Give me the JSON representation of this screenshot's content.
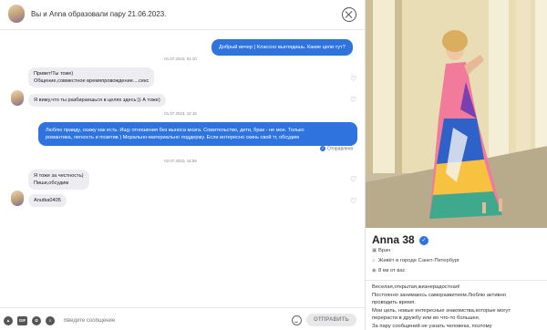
{
  "chat": {
    "header_text": "Вы и Anna образовали пару 21.06.2023.",
    "messages": {
      "m1": "Добрый вечер ) Классно выглядишь. Какие цели тут?",
      "t1": "01.07.2023, 01:10",
      "m2_line1": "Привет!Ты тоже)",
      "m2_line2": "Общение,совместное времяпровождение....секс",
      "m3": "Я вижу,что ты разбираешься в целях здесь:)) А тоже)",
      "t2": "01.07.2023, 12:16",
      "m4_line1": "Люблю правду, скажу как есть. Ищу отношения без выноса мозга. Сожительство, дети, брак - не мое. Только",
      "m4_line2": "романтика, легкость и позитив ) Морально-материально поддержу. Если интересно скинь свой тг, обсудим",
      "status": "Отправлено",
      "t3": "02.07.2023, 14:59",
      "m5_line1": "Я тоже за честность)",
      "m5_line2": "Пиши,обсудим",
      "m6": "Anutka0405"
    },
    "composer": {
      "gif_label": "GIF",
      "input_placeholder": "Введите сообщение",
      "send_label": "ОТПРАВИТЬ"
    }
  },
  "profile": {
    "name": "Anna",
    "age": "38",
    "occupation": "Врач",
    "city": "Живёт в городе Санкт-Петербург",
    "distance": "8 км от вас",
    "about_lines": [
      "Веселая,открытая,жизнерадостная!",
      "Постоянно занимаюсь саморазвитием.Люблю активно",
      "проводить время.",
      "Мои цель, новые интересные знакомства,которые могут",
      "перерасти в дружбу или во что-то большее.",
      "За пару сообщений не узнать человека, поэтому"
    ]
  },
  "colors": {
    "accent": "#2f74de",
    "bubble_in": "#ededf1"
  }
}
